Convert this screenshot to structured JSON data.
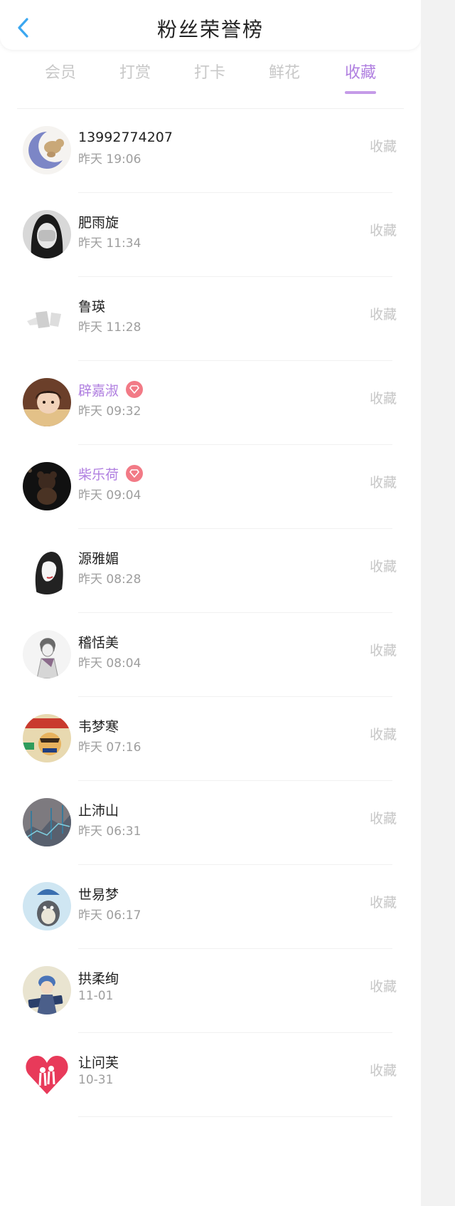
{
  "header": {
    "title": "粉丝荣誉榜",
    "back_icon": "chevron-left-icon",
    "accent_color": "#3ba7f0"
  },
  "tabs": [
    {
      "label": "会员",
      "active": false
    },
    {
      "label": "打赏",
      "active": false
    },
    {
      "label": "打卡",
      "active": false
    },
    {
      "label": "鲜花",
      "active": false
    },
    {
      "label": "收藏",
      "active": true
    }
  ],
  "colors": {
    "tab_active": "#b07fe0",
    "tab_inactive": "#c8c8c8",
    "vip_name": "#b07fe0",
    "vip_badge": "#f27a86"
  },
  "fans": [
    {
      "name": "13992774207",
      "time": "昨天 19:06",
      "action": "收藏",
      "vip": false
    },
    {
      "name": "肥雨旋",
      "time": "昨天 11:34",
      "action": "收藏",
      "vip": false
    },
    {
      "name": "鲁瑛",
      "time": "昨天 11:28",
      "action": "收藏",
      "vip": false
    },
    {
      "name": "辟嘉淑",
      "time": "昨天 09:32",
      "action": "收藏",
      "vip": true
    },
    {
      "name": "柴乐荷",
      "time": "昨天 09:04",
      "action": "收藏",
      "vip": true
    },
    {
      "name": "源雅媚",
      "time": "昨天 08:28",
      "action": "收藏",
      "vip": false
    },
    {
      "name": "稽恬美",
      "time": "昨天 08:04",
      "action": "收藏",
      "vip": false
    },
    {
      "name": "韦梦寒",
      "time": "昨天 07:16",
      "action": "收藏",
      "vip": false
    },
    {
      "name": "止沛山",
      "time": "昨天 06:31",
      "action": "收藏",
      "vip": false
    },
    {
      "name": "世易梦",
      "time": "昨天 06:17",
      "action": "收藏",
      "vip": false
    },
    {
      "name": "拱柔绚",
      "time": "11-01",
      "action": "收藏",
      "vip": false
    },
    {
      "name": "让问芙",
      "time": "10-31",
      "action": "收藏",
      "vip": false
    }
  ]
}
